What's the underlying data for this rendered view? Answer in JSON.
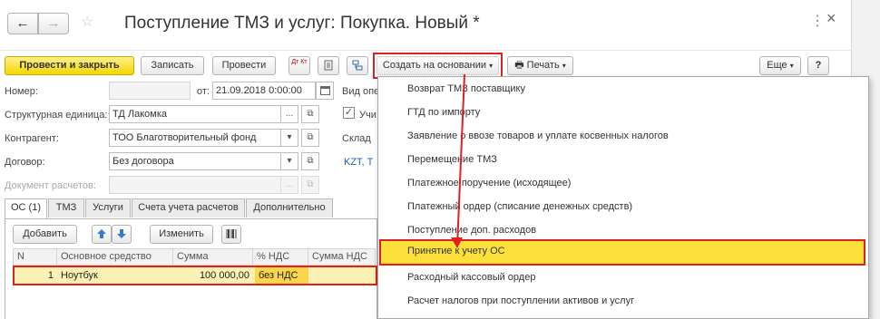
{
  "window": {
    "title": "Поступление ТМЗ и услуг: Покупка. Новый *",
    "nav_back": "←",
    "nav_forward": "→",
    "more_glyph": "⋮",
    "close_glyph": "×"
  },
  "toolbar": {
    "post_close": "Провести и закрыть",
    "save": "Записать",
    "post": "Провести",
    "create_based_on": "Создать на основании",
    "print": "Печать",
    "more": "Еще",
    "help": "?",
    "dt_kt": "Дт Кт"
  },
  "form": {
    "number_label": "Номер:",
    "number_value": "",
    "date_from_label": "от:",
    "date_value": "21.09.2018  0:00:00",
    "op_type_label": "Вид опе",
    "unit_label": "Структурная единица:",
    "unit_value": "ТД Лакомка",
    "counterparty_label": "Контрагент:",
    "counterparty_value": "ТОО Благотворительный фонд",
    "contract_label": "Договор:",
    "contract_value": "Без договора",
    "settlement_doc_label": "Документ расчетов:",
    "settlement_doc_value": "",
    "account_checkbox_label": "Учи",
    "warehouse_label": "Склад",
    "currency_text": "KZT, Т"
  },
  "tabs": [
    {
      "label": "ОС (1)"
    },
    {
      "label": "ТМЗ"
    },
    {
      "label": "Услуги"
    },
    {
      "label": "Счета учета расчетов"
    },
    {
      "label": "Дополнительно"
    }
  ],
  "table_toolbar": {
    "add": "Добавить",
    "change": "Изменить"
  },
  "table": {
    "headers": [
      "N",
      "Основное средство",
      "Сумма",
      "% НДС",
      "Сумма НДС"
    ],
    "rows": [
      {
        "n": "1",
        "asset": "Ноутбук",
        "amount": "100 000,00",
        "vat_rate": "без НДС",
        "vat_amount": ""
      }
    ]
  },
  "dropdown_menu": {
    "items": [
      {
        "label": "Возврат ТМЗ поставщику"
      },
      {
        "label": "ГТД по импорту"
      },
      {
        "label": "Заявление о ввозе товаров и уплате косвенных налогов"
      },
      {
        "label": "Перемещение ТМЗ"
      },
      {
        "label": "Платежное поручение (исходящее)"
      },
      {
        "label": "Платежный ордер (списание денежных средств)"
      },
      {
        "label": "Поступление доп. расходов"
      },
      {
        "label": "Принятие к учету ОС"
      },
      {
        "label": "Расходный кассовый ордер"
      },
      {
        "label": "Расчет налогов при поступлении активов и услуг"
      }
    ],
    "highlighted_index": 7
  },
  "colors": {
    "accent_yellow": "#f5d600",
    "highlight_red": "#e02020",
    "menu_highlight": "#fde03a"
  }
}
